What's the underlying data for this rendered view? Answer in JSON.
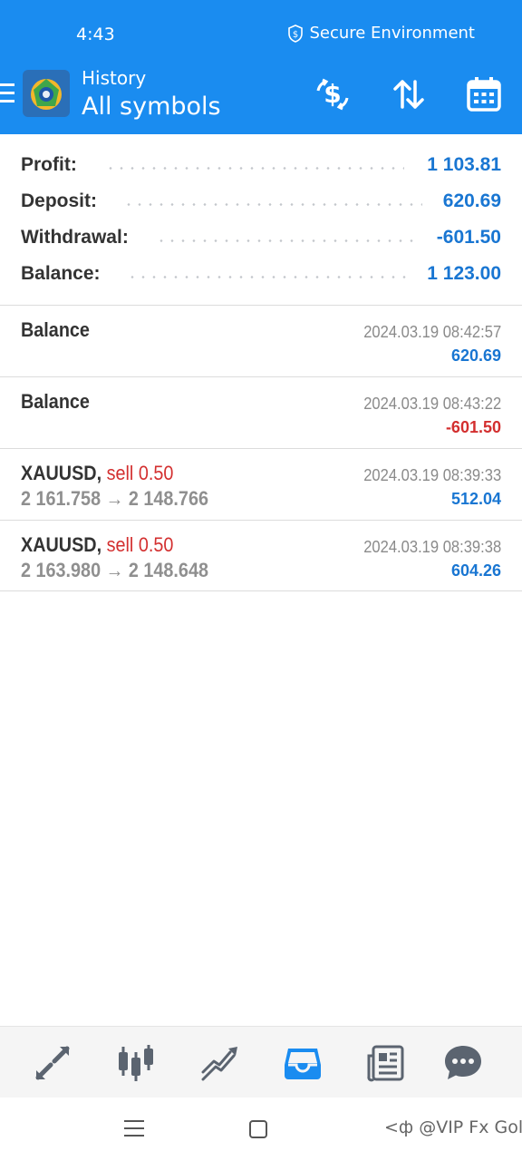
{
  "status_bar": {
    "time": "4:43",
    "secure_label": "Secure Environment"
  },
  "header": {
    "subtitle": "History",
    "title": "All symbols",
    "actions": [
      {
        "icon": "dollar-exchange-icon"
      },
      {
        "icon": "sort-icon"
      },
      {
        "icon": "calendar-icon"
      }
    ],
    "background_color": "#1a8cf0"
  },
  "summary": {
    "profit_label": "Profit:",
    "profit_value": "1 103.81",
    "deposit_label": "Deposit:",
    "deposit_value": "620.69",
    "withdrawal_label": "Withdrawal:",
    "withdrawal_value": "-601.50",
    "balance_label": "Balance:",
    "balance_value": "1 123.00"
  },
  "deals": [
    {
      "title": "Balance",
      "time": "2024.03.19 08:42:57",
      "amount": "620.69",
      "amount_color": "#1976d2"
    },
    {
      "title": "Balance",
      "time": "2024.03.19 08:43:22",
      "amount": "-601.50",
      "amount_color": "#d32f2f"
    },
    {
      "symbol": "XAUUSD,",
      "side": "sell 0.50",
      "prices": "2 161.758 → 2 148.766",
      "time": "2024.03.19 08:39:33",
      "amount": "512.04",
      "amount_color": "#1976d2"
    },
    {
      "symbol": "XAUUSD,",
      "side": "sell 0.50",
      "prices": "2 163.980 → 2 148.648",
      "time": "2024.03.19 08:39:38",
      "amount": "604.26",
      "amount_color": "#1976d2"
    }
  ],
  "tabbar": {
    "tabs": [
      {
        "icon": "quotes-icon",
        "active": false
      },
      {
        "icon": "chart-candles-icon",
        "active": false
      },
      {
        "icon": "trade-icon",
        "active": false
      },
      {
        "icon": "history-inbox-icon",
        "active": true
      },
      {
        "icon": "news-icon",
        "active": false
      },
      {
        "icon": "chat-icon",
        "active": false
      }
    ],
    "active_color": "#1a8cf0",
    "inactive_color": "#5b6470"
  },
  "watermark": "<ф @VIP Fx Gold"
}
